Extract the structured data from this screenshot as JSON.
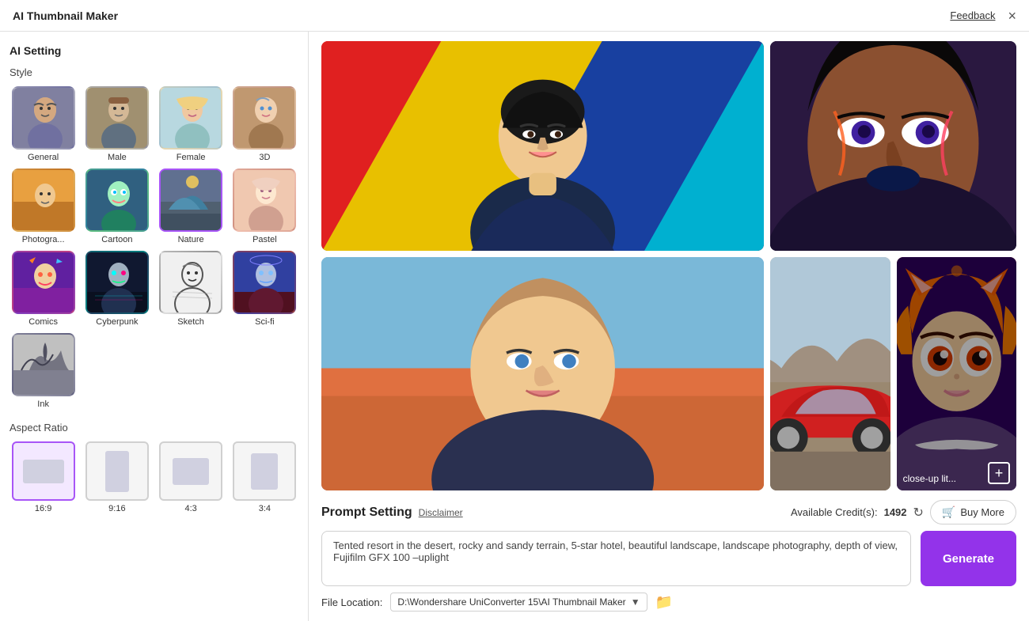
{
  "titleBar": {
    "title": "AI Thumbnail Maker",
    "feedbackLabel": "Feedback",
    "closeLabel": "×"
  },
  "sidebar": {
    "sectionTitle": "AI Setting",
    "styleTitle": "Style",
    "styles": [
      {
        "id": "general",
        "label": "General",
        "selected": false,
        "thumbClass": "thumb-general"
      },
      {
        "id": "male",
        "label": "Male",
        "selected": false,
        "thumbClass": "thumb-male"
      },
      {
        "id": "female",
        "label": "Female",
        "selected": false,
        "thumbClass": "thumb-female"
      },
      {
        "id": "3d",
        "label": "3D",
        "selected": false,
        "thumbClass": "thumb-3d"
      },
      {
        "id": "photog",
        "label": "Photogra...",
        "selected": false,
        "thumbClass": "thumb-photog"
      },
      {
        "id": "cartoon",
        "label": "Cartoon",
        "selected": false,
        "thumbClass": "thumb-cartoon"
      },
      {
        "id": "nature",
        "label": "Nature",
        "selected": false,
        "thumbClass": "thumb-nature"
      },
      {
        "id": "pastel",
        "label": "Pastel",
        "selected": false,
        "thumbClass": "thumb-pastel"
      },
      {
        "id": "comics",
        "label": "Comics",
        "selected": false,
        "thumbClass": "thumb-comics"
      },
      {
        "id": "cyberpunk",
        "label": "Cyberpunk",
        "selected": false,
        "thumbClass": "thumb-cyberpunk"
      },
      {
        "id": "sketch",
        "label": "Sketch",
        "selected": false,
        "thumbClass": "thumb-sketch"
      },
      {
        "id": "scifi",
        "label": "Sci-fi",
        "selected": false,
        "thumbClass": "thumb-scifi"
      },
      {
        "id": "ink",
        "label": "Ink",
        "selected": false,
        "thumbClass": "thumb-ink"
      }
    ],
    "aspectRatioTitle": "Aspect Ratio",
    "aspectRatios": [
      {
        "id": "16-9",
        "label": "16:9",
        "selected": true,
        "cls": "aspect-16-9"
      },
      {
        "id": "9-16",
        "label": "9:16",
        "selected": false,
        "cls": "aspect-9-16"
      },
      {
        "id": "4-3",
        "label": "4:3",
        "selected": false,
        "cls": "aspect-4-3"
      },
      {
        "id": "3-4",
        "label": "3:4",
        "selected": false,
        "cls": "aspect-3-4"
      }
    ]
  },
  "prompt": {
    "title": "Prompt Setting",
    "disclaimerLabel": "Disclaimer",
    "creditsLabel": "Available Credit(s):",
    "creditsCount": "1492",
    "buyMoreLabel": "Buy More",
    "promptText": "Tented resort in the desert, rocky and sandy terrain, 5-star hotel, beautiful landscape, landscape photography, depth of view, Fujifilm GFX 100 –uplight",
    "generateLabel": "Generate"
  },
  "fileLocation": {
    "label": "File Location:",
    "path": "D:\\Wondershare UniConverter 15\\AI Thumbnail Maker",
    "dropdownOptions": [
      "D:\\Wondershare UniConverter 15\\AI Thumbnail Maker"
    ]
  },
  "images": {
    "bottomRightText": "close-up lit...",
    "bottomRightIconLabel": "+"
  }
}
